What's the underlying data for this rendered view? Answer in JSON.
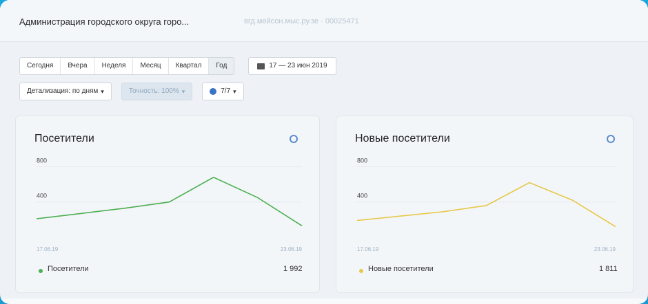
{
  "header": {
    "title": "Администрация городского округа горо...",
    "url": "вгд.мейсон.мыс.ру.зе · 00025471"
  },
  "period_tabs": [
    "Сегодня",
    "Вчера",
    "Неделя",
    "Месяц",
    "Квартал",
    "Год"
  ],
  "active_period": "Год",
  "date_range": "17 — 23 июн 2019",
  "filters": {
    "detail": "Детализация: по дням",
    "accuracy": "Точность: 100%",
    "segment": "7/7"
  },
  "colors": {
    "visitors": "#4caf50",
    "new_visitors": "#e6c84a",
    "accent": "#3b73c4"
  },
  "cards": [
    {
      "title": "Посетители",
      "legend_label": "Посетители",
      "total": "1 992",
      "icon": "help-icon",
      "chart_data": {
        "type": "line",
        "y_ticks": [
          "800",
          "400"
        ],
        "x_ticks": [
          "17.06.19",
          "23.06.19"
        ],
        "x": [
          "17.06.19",
          "18.06.19",
          "19.06.19",
          "20.06.19",
          "21.06.19",
          "22.06.19",
          "23.06.19"
        ],
        "series": [
          {
            "name": "Посетители",
            "values": [
              210,
              270,
              330,
              400,
              680,
              450,
              130
            ]
          }
        ],
        "ylim": [
          0,
          800
        ]
      }
    },
    {
      "title": "Новые посетители",
      "legend_label": "Новые посетители",
      "total": "1 811",
      "icon": "help-icon",
      "chart_data": {
        "type": "line",
        "y_ticks": [
          "800",
          "400"
        ],
        "x_ticks": [
          "17.06.19",
          "23.06.19"
        ],
        "x": [
          "17.06.19",
          "18.06.19",
          "19.06.19",
          "20.06.19",
          "21.06.19",
          "22.06.19",
          "23.06.19"
        ],
        "series": [
          {
            "name": "Новые посетители",
            "values": [
              190,
              240,
              290,
              360,
              620,
              420,
              120
            ]
          }
        ],
        "ylim": [
          0,
          800
        ]
      }
    }
  ]
}
